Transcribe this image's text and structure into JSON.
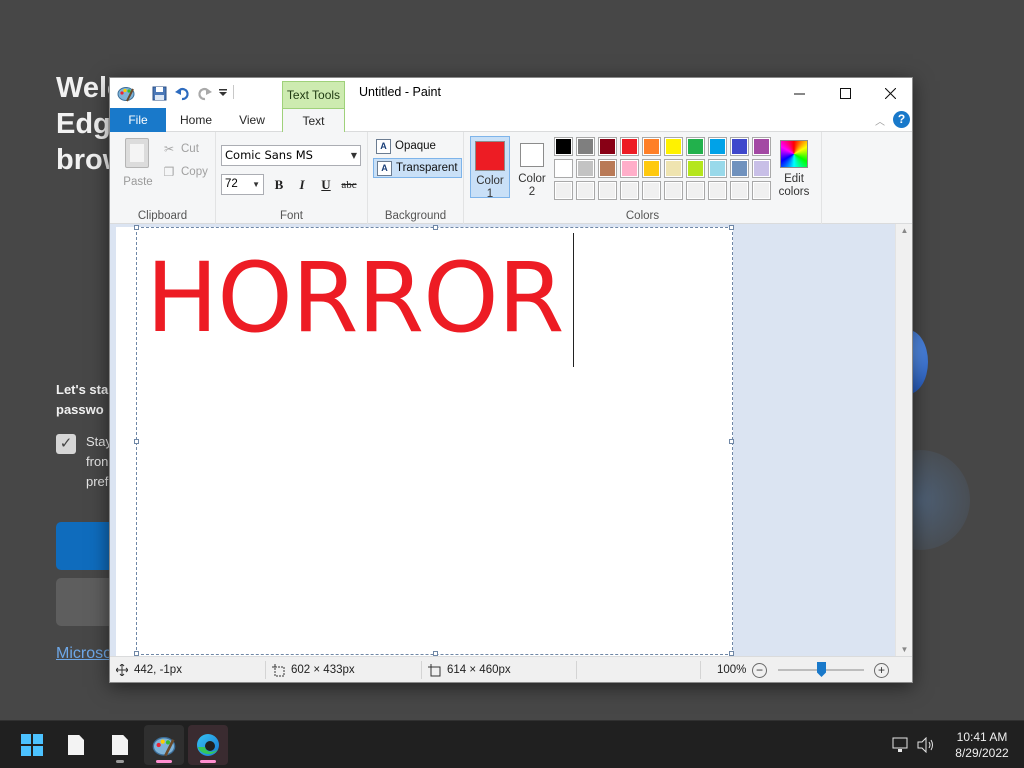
{
  "background_page": {
    "title_lines": [
      "Welc",
      "Edge",
      "brow"
    ],
    "subtitle_lines": [
      "Let's sta",
      "passwo"
    ],
    "checkbox_text_lines": [
      "Stay",
      "fron",
      "pref"
    ],
    "footer_link": "Microso"
  },
  "paint": {
    "window_title": "Untitled - Paint",
    "contextual_tab": "Text Tools",
    "tabs": [
      "File",
      "Home",
      "View",
      "Text"
    ],
    "active_tab": "Text",
    "clipboard": {
      "paste_label": "Paste",
      "cut_label": "Cut",
      "copy_label": "Copy",
      "group_label": "Clipboard"
    },
    "font": {
      "family": "Comic Sans MS",
      "size": "72",
      "bold_label": "B",
      "italic_label": "I",
      "underline_label": "U",
      "strike_label": "abc",
      "group_label": "Font"
    },
    "background": {
      "opaque_label": "Opaque",
      "transparent_label": "Transparent",
      "selected": "Transparent",
      "group_label": "Background"
    },
    "colors": {
      "color1_label_a": "Color",
      "color1_label_b": "1",
      "color2_label_a": "Color",
      "color2_label_b": "2",
      "color1": "#ed1c24",
      "color2": "#ffffff",
      "edit_label_a": "Edit",
      "edit_label_b": "colors",
      "group_label": "Colors",
      "palette_row1": [
        "#000000",
        "#7f7f7f",
        "#880015",
        "#ed1c24",
        "#ff7f27",
        "#fff200",
        "#22b14c",
        "#00a2e8",
        "#3f48cc",
        "#a349a4"
      ],
      "palette_row2": [
        "#ffffff",
        "#c3c3c3",
        "#b97a57",
        "#ffaec9",
        "#ffc90e",
        "#efe4b0",
        "#b5e61d",
        "#99d9ea",
        "#7092be",
        "#c8bfe7"
      ],
      "palette_row3": [
        "#f0f0f0",
        "#f0f0f0",
        "#f0f0f0",
        "#f0f0f0",
        "#f0f0f0",
        "#f0f0f0",
        "#f0f0f0",
        "#f0f0f0",
        "#f0f0f0",
        "#f0f0f0"
      ]
    },
    "canvas_text": "HORROR",
    "text_color": "#ed1c24",
    "status": {
      "cursor_pos": "442, -1px",
      "selection_size": "602 × 433px",
      "image_size": "614 × 460px",
      "zoom": "100%"
    }
  },
  "taskbar": {
    "time": "10:41 AM",
    "date": "8/29/2022"
  }
}
